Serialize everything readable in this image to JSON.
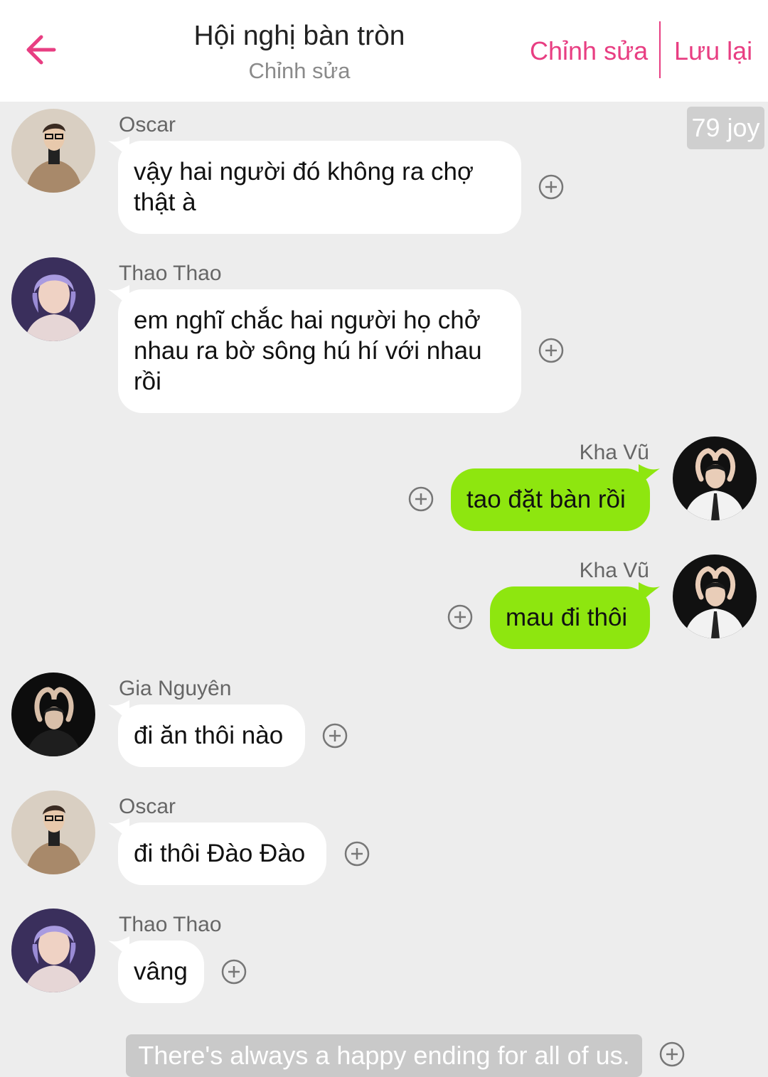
{
  "header": {
    "title": "Hội nghị bàn tròn",
    "subtitle": "Chỉnh sửa",
    "edit_label": "Chỉnh sửa",
    "save_label": "Lưu lại",
    "accent_color": "#e83e82",
    "back_icon": "arrow-left-icon"
  },
  "joy_badge": "79 joy",
  "messages": [
    {
      "sender": "Oscar",
      "side": "left",
      "lines": [
        "vậy hai người đó không ra chợ",
        "thật à"
      ]
    },
    {
      "sender": "Thao Thao",
      "side": "left",
      "lines": [
        "em nghĩ chắc hai người họ chở",
        "nhau ra bờ sông hú hí với nhau",
        "rồi"
      ]
    },
    {
      "sender": "Kha Vũ",
      "side": "right",
      "lines": [
        "tao đặt bàn rồi"
      ]
    },
    {
      "sender": "Kha Vũ",
      "side": "right",
      "lines": [
        "mau đi thôi"
      ]
    },
    {
      "sender": "Gia Nguyên",
      "side": "left",
      "lines": [
        "đi ăn thôi nào"
      ]
    },
    {
      "sender": "Oscar",
      "side": "left",
      "lines": [
        "đi thôi Đào Đào"
      ]
    },
    {
      "sender": "Thao Thao",
      "side": "left",
      "lines": [
        "vâng"
      ]
    }
  ],
  "footer_text": "There's always a happy ending for all of us.",
  "colors": {
    "background": "#ededed",
    "left_bubble": "#ffffff",
    "right_bubble": "#8ee60f",
    "name_text": "#666666"
  },
  "icons": {
    "add": "plus-circle-icon"
  }
}
